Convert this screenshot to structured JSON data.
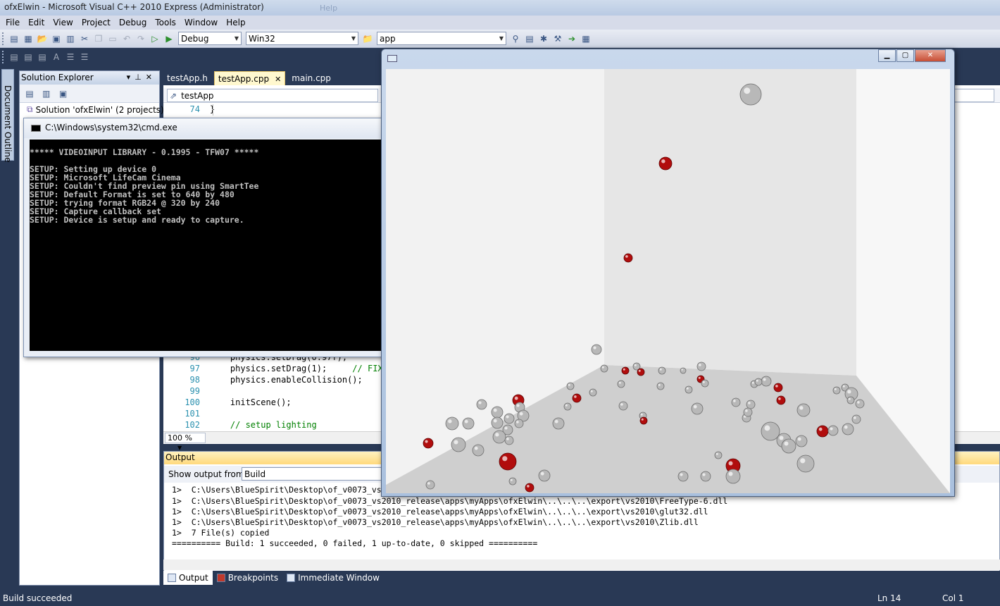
{
  "window": {
    "title": "ofxElwin - Microsoft Visual C++ 2010 Express (Administrator)",
    "ghost_menu": [
      "Help"
    ]
  },
  "menu": [
    "File",
    "Edit",
    "View",
    "Project",
    "Debug",
    "Tools",
    "Window",
    "Help"
  ],
  "toolbar": {
    "configuration": "Debug",
    "platform": "Win32",
    "find": "app"
  },
  "doc_outline": {
    "label": "Document Outline"
  },
  "solution_explorer": {
    "title": "Solution Explorer",
    "root": "Solution 'ofxElwin' (2 projects)"
  },
  "editor": {
    "tabs": [
      {
        "label": "testApp.h",
        "active": false
      },
      {
        "label": "testApp.cpp",
        "active": true
      },
      {
        "label": "main.cpp",
        "active": false
      }
    ],
    "nav_scope": "testApp",
    "lines": [
      {
        "n": "74",
        "code": "}",
        "comment": ""
      },
      {
        "n": "96",
        "code": "    physics.setDrag(0.97f);",
        "comment": ""
      },
      {
        "n": "97",
        "code": "    physics.setDrag(1);     ",
        "comment": "// FIX"
      },
      {
        "n": "98",
        "code": "    physics.enableCollision();",
        "comment": ""
      },
      {
        "n": "99",
        "code": "",
        "comment": ""
      },
      {
        "n": "100",
        "code": "    initScene();",
        "comment": ""
      },
      {
        "n": "101",
        "code": "",
        "comment": ""
      },
      {
        "n": "102",
        "code": "    ",
        "comment": "// setup lighting"
      }
    ],
    "zoom": "100 %"
  },
  "output": {
    "title": "Output",
    "show_label": "Show output from:",
    "source": "Build",
    "lines": [
      "1>  C:\\Users\\BlueSpirit\\Desktop\\of_v0073_vs",
      "1>  C:\\Users\\BlueSpirit\\Desktop\\of_v0073_vs2010_release\\apps\\myApps\\ofxElwin\\..\\..\\..\\export\\vs2010\\FreeType-6.dll",
      "1>  C:\\Users\\BlueSpirit\\Desktop\\of_v0073_vs2010_release\\apps\\myApps\\ofxElwin\\..\\..\\..\\export\\vs2010\\glut32.dll",
      "1>  C:\\Users\\BlueSpirit\\Desktop\\of_v0073_vs2010_release\\apps\\myApps\\ofxElwin\\..\\..\\..\\export\\vs2010\\Zlib.dll",
      "1>  7 File(s) copied",
      "========== Build: 1 succeeded, 0 failed, 1 up-to-date, 0 skipped =========="
    ],
    "tabs": [
      "Output",
      "Breakpoints",
      "Immediate Window"
    ]
  },
  "status": {
    "message": "Build succeeded",
    "ln": "Ln 14",
    "col": "Col 1"
  },
  "cmd": {
    "title": "C:\\Windows\\system32\\cmd.exe",
    "text": "***** VIDEOINPUT LIBRARY - 0.1995 - TFW07 *****\n\nSETUP: Setting up device 0\nSETUP: Microsoft LifeCam Cinema\nSETUP: Couldn't find preview pin using SmartTee\nSETUP: Default Format is set to 640 by 480\nSETUP: trying format RGB24 @ 320 by 240\nSETUP: Capture callback set\nSETUP: Device is setup and ready to capture."
  },
  "ofx_window": {
    "colors": {
      "ball_grey": "#b8b8b8",
      "ball_red": "#b10d0d",
      "wall": "#e6e6e6",
      "floor": "#cfcfcf"
    }
  }
}
